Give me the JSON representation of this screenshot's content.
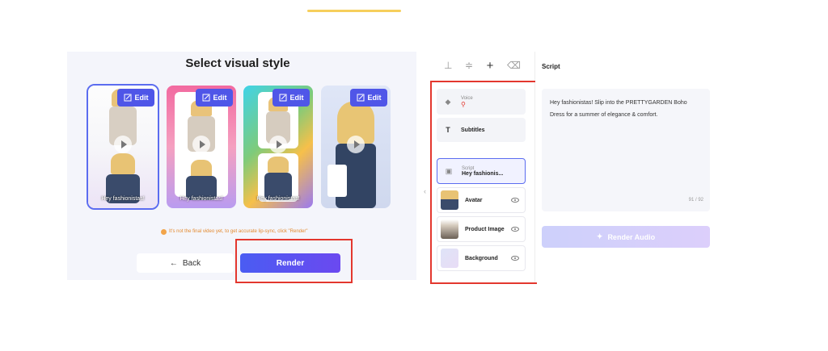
{
  "left": {
    "title": "Select visual style",
    "cards": [
      {
        "edit_label": "Edit",
        "caption": "Hey fashionistas!"
      },
      {
        "edit_label": "Edit",
        "caption": "Hey fashionistas!"
      },
      {
        "edit_label": "Edit",
        "caption": "Hey fashionistas!"
      },
      {
        "edit_label": "Edit",
        "caption": ""
      }
    ],
    "notice": "It's not the final video yet, to get accurate lip-sync, click \"Render\"",
    "back_label": "Back",
    "render_label": "Render"
  },
  "layers": {
    "voice_label": "Voice",
    "subtitles_label": "Subtitles",
    "script_small": "Script",
    "script_preview": "Hey fashionis...",
    "avatar_label": "Avatar",
    "product_label": "Product Image",
    "background_label": "Background"
  },
  "right": {
    "label": "Script",
    "script_text": "Hey fashionistas! Slip into the PRETTYGARDEN Boho Dress for a summer of elegance & comfort.",
    "counter": "91 / 92",
    "render_audio_label": "Render Audio"
  },
  "colors": {
    "accent": "#4f56e8",
    "highlight_red": "#e3372e",
    "top_accent": "#f6cf5c"
  }
}
